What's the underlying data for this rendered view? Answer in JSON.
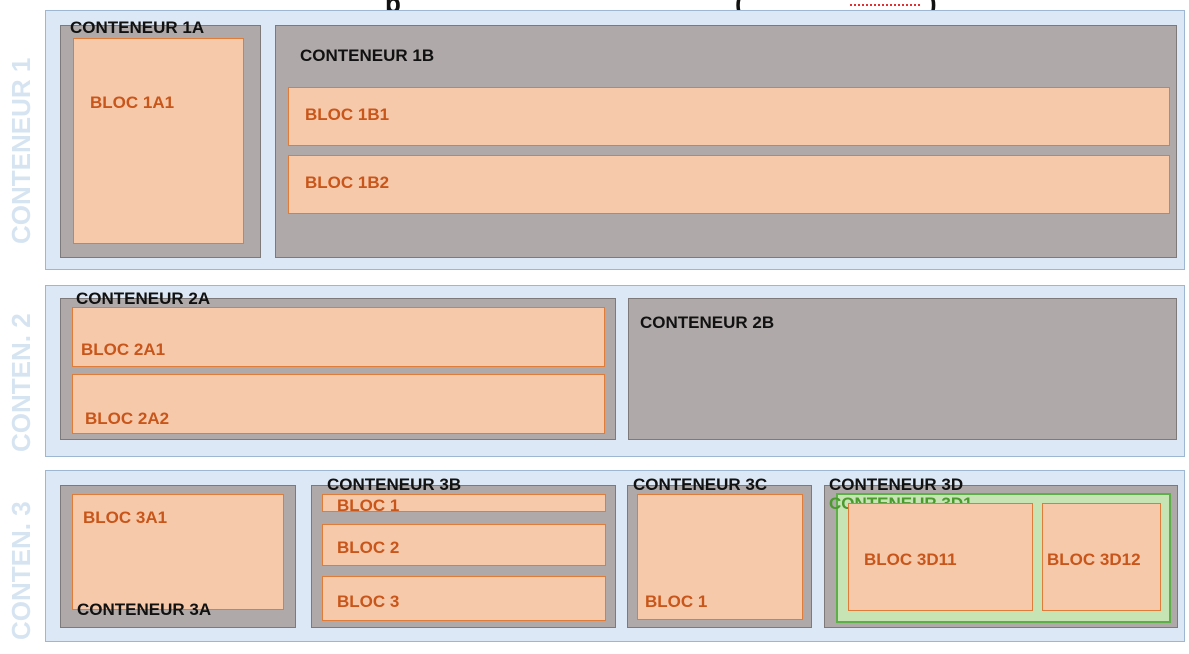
{
  "title_fragment_left": "p",
  "title_fragment_right": "(",
  "title_fragment_right2": ")",
  "containers": {
    "c1": "CONTENEUR 1",
    "c2": "CONTEN. 2",
    "c3": "CONTEN. 3",
    "c1a": "CONTENEUR 1A",
    "c1b": "CONTENEUR 1B",
    "c2a": "CONTENEUR 2A",
    "c2b": "CONTENEUR 2B",
    "c3a": "CONTENEUR 3A",
    "c3b": "CONTENEUR 3B",
    "c3c": "CONTENEUR 3C",
    "c3d": "CONTENEUR 3D",
    "c3d1": "CONTENEUR 3D1"
  },
  "blocs": {
    "b1a1": "BLOC 1A1",
    "b1b1": "BLOC 1B1",
    "b1b2": "BLOC 1B2",
    "b2a1": "BLOC 2A1",
    "b2a2": "BLOC 2A2",
    "b3a1": "BLOC 3A1",
    "b3b1": "BLOC 1",
    "b3b2": "BLOC 2",
    "b3b3": "BLOC 3",
    "b3c1": "BLOC 1",
    "b3d11": "BLOC 3D11",
    "b3d12": "BLOC 3D12"
  },
  "colors": {
    "outer": "#dce8f5",
    "container": "#afaaa9",
    "bloc": "#f7c9ab",
    "bloc_text": "#c8561a",
    "green_container": "#c7e4b5"
  }
}
